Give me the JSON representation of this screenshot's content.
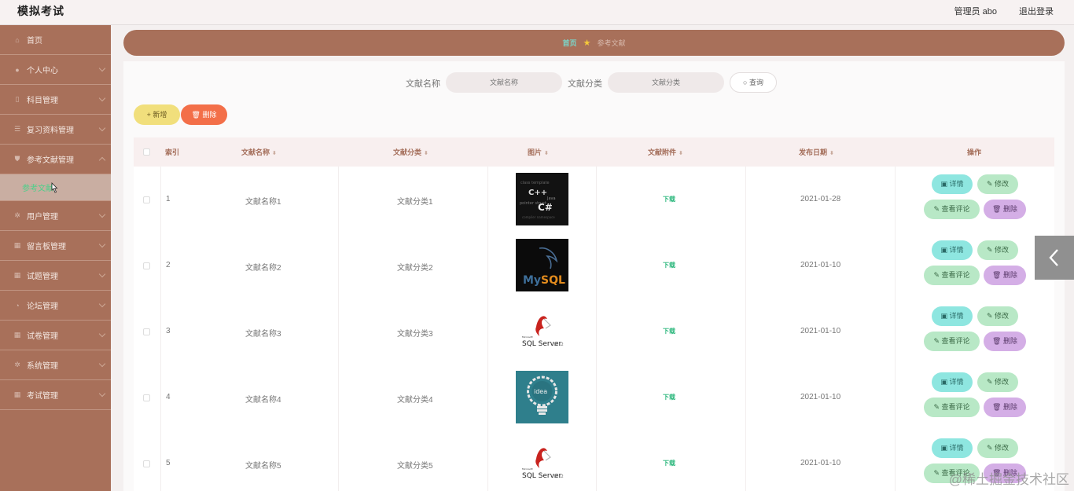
{
  "app": {
    "title": "模拟考试",
    "admin_label": "管理员 abo",
    "logout": "退出登录"
  },
  "sidebar": {
    "items": [
      {
        "label": "首页",
        "icon": "home-icon"
      },
      {
        "label": "个人中心",
        "icon": "user-icon"
      },
      {
        "label": "科目管理",
        "icon": "book-icon"
      },
      {
        "label": "复习资料管理",
        "icon": "list-icon"
      },
      {
        "label": "参考文献管理",
        "icon": "shield-icon"
      },
      {
        "label": "用户管理",
        "icon": "cog-icon"
      },
      {
        "label": "留言板管理",
        "icon": "grid-icon"
      },
      {
        "label": "试题管理",
        "icon": "grid-icon"
      },
      {
        "label": "论坛管理",
        "icon": "chat-icon"
      },
      {
        "label": "试卷管理",
        "icon": "grid-icon"
      },
      {
        "label": "系统管理",
        "icon": "cog-icon"
      },
      {
        "label": "考试管理",
        "icon": "grid-icon"
      }
    ],
    "active_sub": "参考文献"
  },
  "breadcrumb": {
    "home": "首页",
    "current": "参考文献"
  },
  "search": {
    "name_label": "文献名称",
    "name_placeholder": "文献名称",
    "category_label": "文献分类",
    "category_placeholder": "文献分类",
    "query_button": "查询"
  },
  "toolbar": {
    "add_label": "+ 新增",
    "delete_label": "删除"
  },
  "table": {
    "headers": {
      "index": "索引",
      "name": "文献名称",
      "category": "文献分类",
      "image": "图片",
      "attachment": "文献附件",
      "date": "发布日期",
      "actions": "操作"
    },
    "actions": {
      "detail": "详情",
      "edit": "修改",
      "comment": "查看评论",
      "delete": "删除"
    },
    "rows": [
      {
        "index": "1",
        "name": "文献名称1",
        "category": "文献分类1",
        "attachment": "下载",
        "date": "2021-01-28",
        "image": "cpp-word-cloud"
      },
      {
        "index": "2",
        "name": "文献名称2",
        "category": "文献分类2",
        "attachment": "下载",
        "date": "2021-01-10",
        "image": "mysql-logo"
      },
      {
        "index": "3",
        "name": "文献名称3",
        "category": "文献分类3",
        "attachment": "下载",
        "date": "2021-01-10",
        "image": "sql-server-logo"
      },
      {
        "index": "4",
        "name": "文献名称4",
        "category": "文献分类4",
        "attachment": "下载",
        "date": "2021-01-10",
        "image": "idea-bulb"
      },
      {
        "index": "5",
        "name": "文献名称5",
        "category": "文献分类5",
        "attachment": "下载",
        "date": "2021-01-10",
        "image": "sql-server-logo"
      }
    ]
  },
  "watermark": "@稀土掘金技术社区",
  "colors": {
    "sidebar": "#a8705a",
    "accent_green": "#2bb77c",
    "add_button": "#f1df7c",
    "delete_button": "#f36f49"
  }
}
